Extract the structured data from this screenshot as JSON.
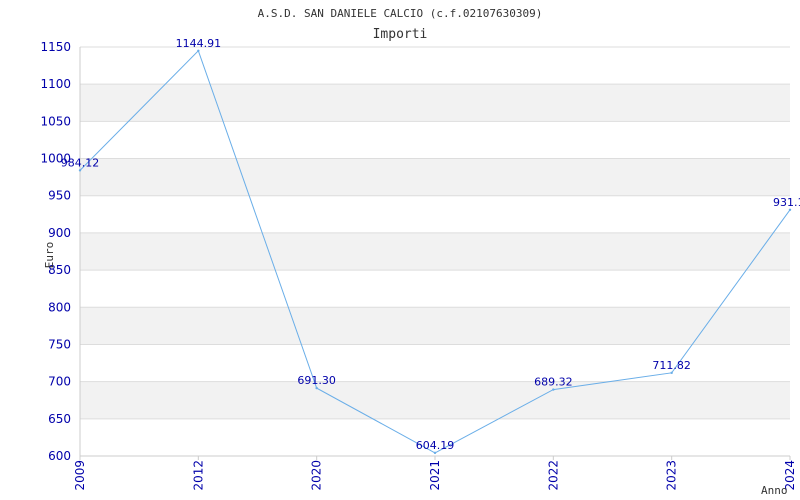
{
  "chart_data": {
    "type": "line",
    "title": "A.S.D. SAN DANIELE CALCIO (c.f.02107630309)",
    "subtitle": "Importi",
    "xlabel": "Anno",
    "ylabel": "Euro",
    "categories": [
      "2009",
      "2012",
      "2020",
      "2021",
      "2022",
      "2023",
      "2024"
    ],
    "series": [
      {
        "values": [
          984.12,
          1144.91,
          691.3,
          604.19,
          689.32,
          711.82,
          931.1
        ],
        "labels": [
          "984.12",
          "1144.91",
          "691.30",
          "604.19",
          "689.32",
          "711.82",
          "931.1"
        ]
      }
    ],
    "ylim": [
      600,
      1150
    ],
    "yticks": [
      "600",
      "650",
      "700",
      "750",
      "800",
      "850",
      "900",
      "950",
      "1000",
      "1050",
      "1100",
      "1150"
    ],
    "grid": true,
    "colors": {
      "line": "#6aaee8",
      "axis_text": "#0000aa",
      "band": "#f2f2f2",
      "gridline": "#dddddd",
      "title": "#333333"
    }
  }
}
